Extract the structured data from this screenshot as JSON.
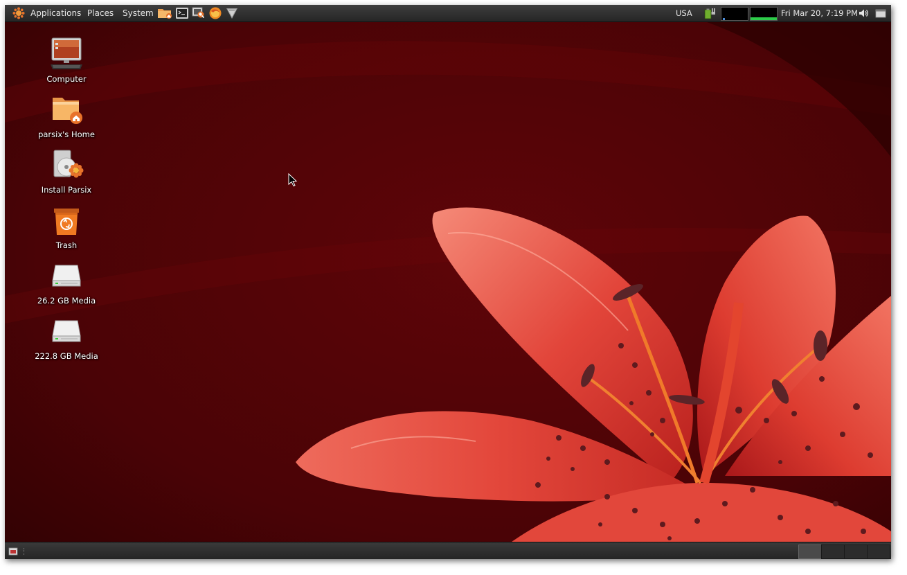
{
  "top_panel": {
    "menus": [
      {
        "label": "Applications"
      },
      {
        "label": "Places"
      },
      {
        "label": "System"
      }
    ],
    "launchers": [
      {
        "icon": "home-folder-icon"
      },
      {
        "icon": "terminal-icon"
      },
      {
        "icon": "search-icon"
      },
      {
        "icon": "firefox-icon"
      },
      {
        "icon": "vlc-icon"
      }
    ],
    "keyboard_layout": "USA",
    "clock": "Fri Mar 20,  7:19 PM",
    "network_monitor_level": 0.15,
    "cpu_monitor_level": 0.2
  },
  "desktop": {
    "icons": [
      {
        "label": "Computer",
        "icon": "computer-icon"
      },
      {
        "label": "parsix's Home",
        "icon": "home-folder-icon"
      },
      {
        "label": "Install Parsix",
        "icon": "install-disc-icon"
      },
      {
        "label": "Trash",
        "icon": "trash-icon"
      },
      {
        "label": "26.2 GB Media",
        "icon": "hard-drive-icon"
      },
      {
        "label": "222.8 GB Media",
        "icon": "hard-drive-icon"
      }
    ]
  },
  "bottom_panel": {
    "workspaces": 4,
    "active_workspace": 1
  },
  "colors": {
    "accent": "#e8732a",
    "panel": "#303030",
    "wallpaper_dark": "#3a0204",
    "wallpaper_red": "#e84a3c"
  }
}
